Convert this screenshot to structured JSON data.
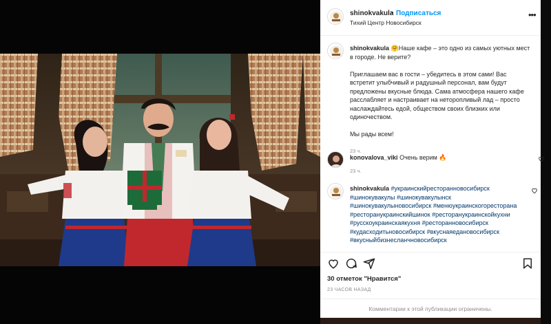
{
  "post": {
    "username": "shinokvakula",
    "follow_label": "Подписаться",
    "location": "Тихий Центр Новосибирск",
    "caption_emoji": "🤗",
    "caption_p1": "Наше кафе – это одно из самых уютных мест в городе. Не верите?",
    "caption_p2": "Приглашаем вас в гости – убедитесь в этом сами! Вас встретит улыбчивый и радушный персонал, вам будут предложены вкусные блюда. Сама атмосфера нашего кафе расслабляет и настраивает на неторопливый лад – просто наслаждайтесь едой, обществом своих близких или одиночеством.",
    "caption_p3": "Мы рады всем!",
    "caption_time": "23 ч."
  },
  "comments": [
    {
      "username": "konovalova_viki",
      "text": "Очень верим",
      "emoji": "🔥",
      "time": "23 ч."
    },
    {
      "username": "shinokvakula",
      "hashtags": "#украинскийресторанновосибирск #шинокувакулы #шинокувакулынск #шинокувакулыновосибирск #менюукраинскогоресторана #ресторанукраинскийшинок #ресторанукраинскойкухни #русскоукраинскаякухня #ресторанновосибирск #кудасходитьновосибирск #вкуснаяедановосибирск #вкусныйбизнесланчновосибирск"
    }
  ],
  "engagement": {
    "likes": "30 отметок \"Нравится\"",
    "posted_ago": "23 ЧАСОВ НАЗАД",
    "comments_restricted": "Комментарии к этой публикации ограничены."
  },
  "icons": {
    "more": "more-options-icon",
    "like": "heart-icon",
    "comment": "comment-icon",
    "share": "share-icon",
    "save": "bookmark-icon"
  },
  "colors": {
    "link_blue": "#0095f6",
    "hashtag_blue": "#00376b",
    "meta_gray": "#8e8e8e",
    "text": "#262626",
    "backdrop": "#050505"
  }
}
